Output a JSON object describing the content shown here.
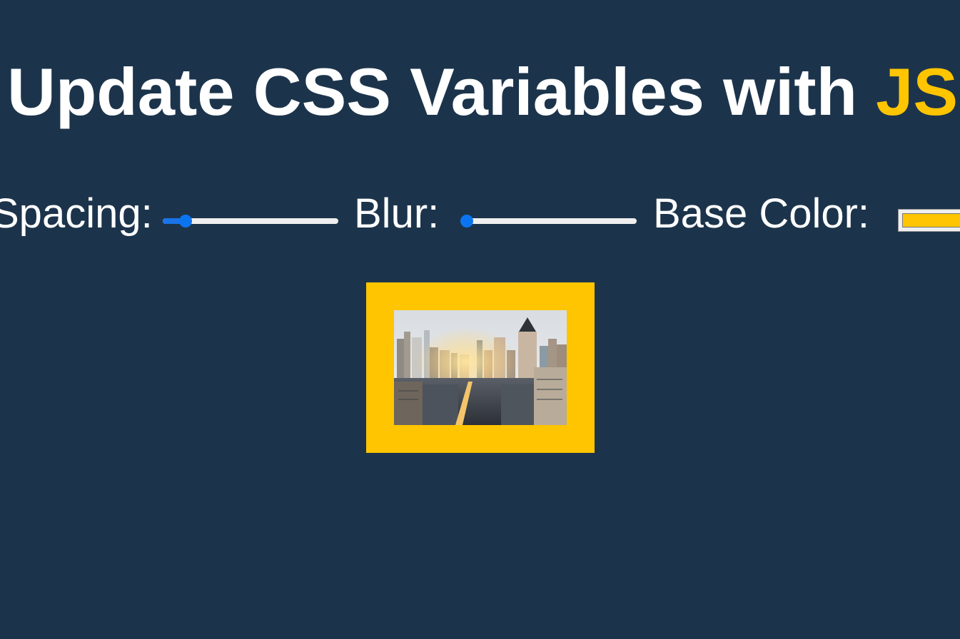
{
  "title": {
    "main": "Update CSS Variables with ",
    "highlight": "JS"
  },
  "controls": {
    "spacing": {
      "label": "Spacing:",
      "value": 10,
      "min": 0,
      "max": 100
    },
    "blur": {
      "label": "Blur:",
      "value": 0,
      "min": 0,
      "max": 25
    },
    "base_color": {
      "label": "Base Color:",
      "value": "#ffc500"
    }
  },
  "colors": {
    "background": "#1c344b",
    "accent": "#ffc500",
    "slider": "#0b75f1"
  },
  "image": {
    "alt": "city skyline photo",
    "icon": "city-skyline-image"
  }
}
